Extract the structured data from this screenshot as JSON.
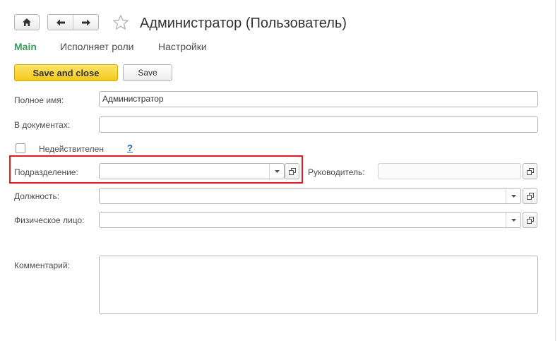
{
  "window": {
    "title": "Администратор (Пользователь)"
  },
  "nav": {
    "home_icon": "home-icon",
    "back_icon": "arrow-left-icon",
    "forward_icon": "arrow-right-icon",
    "favorite_icon": "star-icon"
  },
  "tabs": [
    {
      "label": "Main",
      "active": true
    },
    {
      "label": "Исполняет роли",
      "active": false
    },
    {
      "label": "Настройки",
      "active": false
    }
  ],
  "toolbar": {
    "save_close_label": "Save and close",
    "save_label": "Save"
  },
  "form": {
    "full_name": {
      "label": "Полное имя:",
      "value": "Администратор"
    },
    "in_documents": {
      "label": "В документах:",
      "value": ""
    },
    "invalid": {
      "label": "Недействителен",
      "checked": false,
      "help": "?"
    },
    "department": {
      "label": "Подразделение:",
      "value": ""
    },
    "manager": {
      "label": "Руководитель:",
      "value": ""
    },
    "position": {
      "label": "Должность:",
      "value": ""
    },
    "individual": {
      "label": "Физическое лицо:",
      "value": ""
    },
    "comment": {
      "label": "Комментарий:",
      "value": ""
    }
  },
  "colors": {
    "accent_tab": "#3a9f59",
    "primary_button": "#f3c81b",
    "highlight": "#e11b1b",
    "help_link": "#1f5fbf"
  }
}
